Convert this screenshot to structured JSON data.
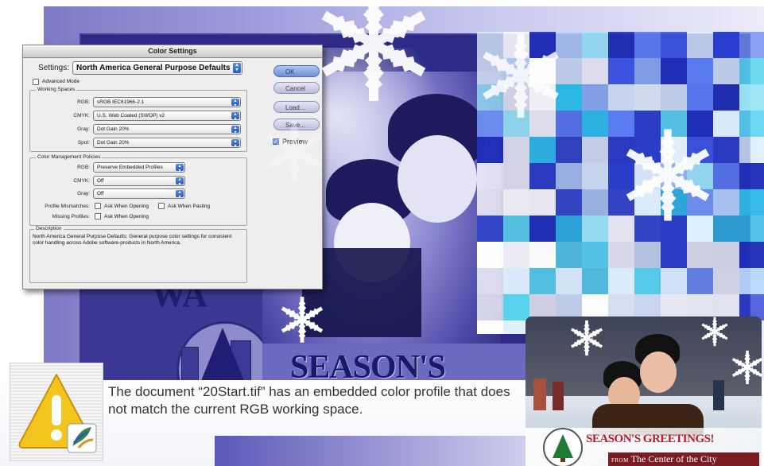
{
  "dialog": {
    "title": "Color Settings",
    "settings_label": "Settings:",
    "settings_value": "North America General Purpose Defaults",
    "advanced_mode_label": "Advanced Mode",
    "working_spaces": {
      "title": "Working Spaces",
      "rows": [
        {
          "label": "RGB:",
          "value": "sRGB IEC61966-2.1"
        },
        {
          "label": "CMYK:",
          "value": "U.S. Web Coated (SWOP) v2"
        },
        {
          "label": "Gray:",
          "value": "Dot Gain 20%"
        },
        {
          "label": "Spot:",
          "value": "Dot Gain 20%"
        }
      ]
    },
    "policies": {
      "title": "Color Management Policies",
      "rows": [
        {
          "label": "RGB:",
          "value": "Preserve Embedded Profiles"
        },
        {
          "label": "CMYK:",
          "value": "Off"
        },
        {
          "label": "Gray:",
          "value": "Off"
        }
      ],
      "mismatch_label": "Profile Mismatches:",
      "ask_opening": "Ask When Opening",
      "ask_pasting": "Ask When Pasting",
      "missing_label": "Missing Profiles:",
      "missing_ask_opening": "Ask When Opening"
    },
    "description": {
      "title": "Description",
      "text": "North America General Purpose Defaults:  General purpose color settings for consistent color handling across Adobe software-products in North America."
    },
    "buttons": {
      "ok": "OK",
      "cancel": "Cancel",
      "load": "Load...",
      "save": "Save...",
      "preview": "Preview"
    }
  },
  "artwork": {
    "seasons_text": "SEASON'S",
    "wall_text": "WA"
  },
  "alert": {
    "icon": "warning-icon",
    "message": "The document “20Start.tif” has an embedded color profile that does not match the current RGB working space."
  },
  "greeting_card": {
    "title": "SEASON'S GREETINGS!",
    "from": "FROM",
    "subtitle": "The Center of the City"
  },
  "colors": {
    "accent": "#2f6fd6",
    "mosaic_blue": "#2a3fd0",
    "banner_red": "#c0182a"
  }
}
